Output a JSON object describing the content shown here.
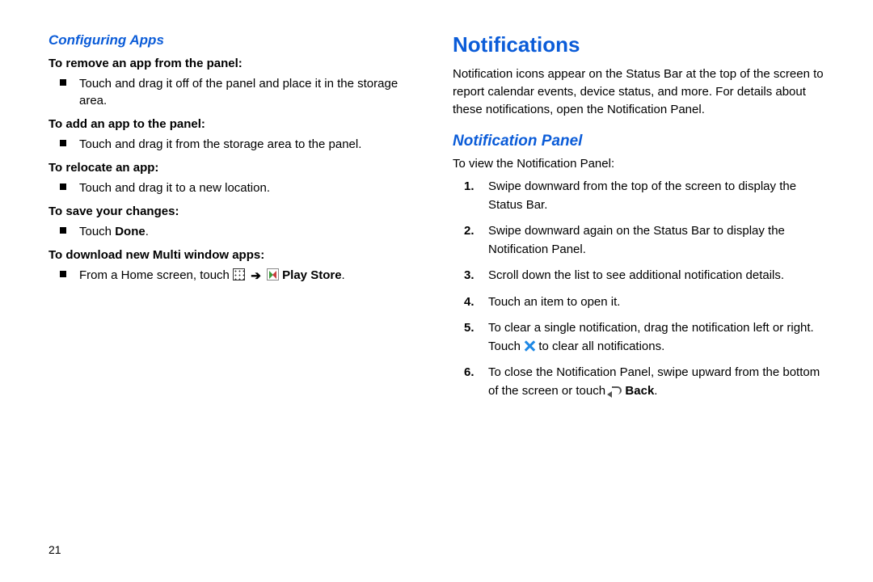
{
  "left": {
    "heading": "Configuring Apps",
    "sections": [
      {
        "title": "To remove an app from the panel:",
        "bullet": "Touch and drag it off of the panel and place it in the storage area."
      },
      {
        "title": "To add an app to the panel:",
        "bullet": "Touch and drag it from the storage area to the panel."
      },
      {
        "title": "To relocate an app:",
        "bullet": "Touch and drag it to a new location."
      },
      {
        "title": "To save your changes:",
        "bullet_prefix": "Touch ",
        "bullet_bold": "Done",
        "bullet_suffix": "."
      },
      {
        "title": "To download new Multi window apps:",
        "bullet_prefix": "From a Home screen, touch ",
        "arrow": "➔",
        "store_label": " Play Store",
        "bullet_suffix": "."
      }
    ]
  },
  "right": {
    "heading": "Notifications",
    "intro": "Notification icons appear on the Status Bar at the top of the screen to report calendar events, device status, and more. For details about these notifications, open the Notification Panel.",
    "subheading": "Notification Panel",
    "lead": "To view the Notification Panel:",
    "steps": [
      {
        "n": "1.",
        "text": "Swipe downward from the top of the screen to display the Status Bar."
      },
      {
        "n": "2.",
        "text": "Swipe downward again on the Status Bar to display the Notification Panel."
      },
      {
        "n": "3.",
        "text": "Scroll down the list to see additional notification details."
      },
      {
        "n": "4.",
        "text": "Touch an item to open it."
      },
      {
        "n": "5.",
        "pre": "To clear a single notification, drag the notification left or right. Touch ",
        "post": " to clear all notifications."
      },
      {
        "n": "6.",
        "pre": "To close the Notification Panel, swipe upward from the bottom of the screen or touch ",
        "bold": " Back",
        "post": "."
      }
    ]
  },
  "page_number": "21"
}
